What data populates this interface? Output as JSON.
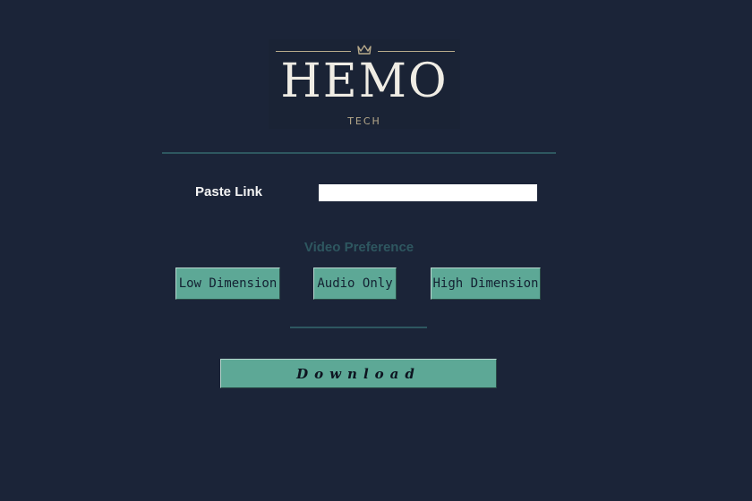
{
  "logo": {
    "main": "HEMO",
    "sub": "TECH",
    "crown_icon": "crown-icon",
    "accent": "#b7a98a"
  },
  "form": {
    "paste_label": "Paste Link",
    "link_value": "",
    "preference_label": "Video Preference",
    "options": [
      "Low Dimension",
      "Audio Only",
      "High Dimension"
    ],
    "download_label": "Download"
  },
  "colors": {
    "background": "#1b2438",
    "button": "#5da896",
    "divider": "#2e5760",
    "label_muted": "#2e5760"
  }
}
